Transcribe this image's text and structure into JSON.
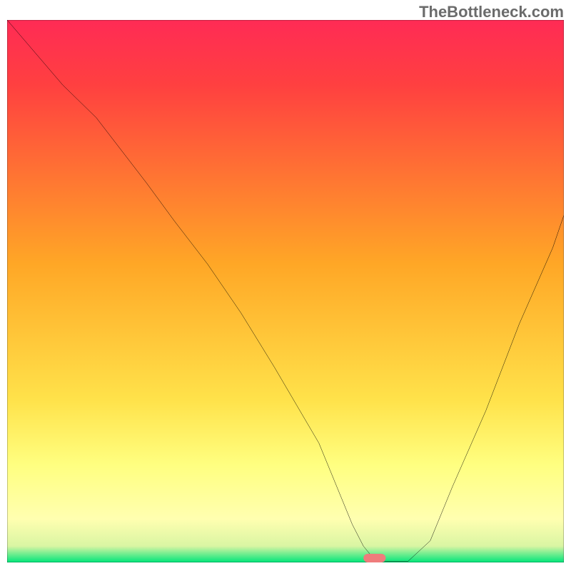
{
  "watermark": "TheBottleneck.com",
  "chart_data": {
    "type": "line",
    "x_range": [
      0,
      100
    ],
    "y_range": [
      0,
      100
    ],
    "xlabel": "",
    "ylabel": "",
    "title": "",
    "background_gradient_stops": [
      {
        "offset": 0.0,
        "color": "#ff2b55"
      },
      {
        "offset": 0.12,
        "color": "#ff4040"
      },
      {
        "offset": 0.45,
        "color": "#ffa726"
      },
      {
        "offset": 0.7,
        "color": "#ffe24a"
      },
      {
        "offset": 0.82,
        "color": "#ffff80"
      },
      {
        "offset": 0.92,
        "color": "#ffffb0"
      },
      {
        "offset": 0.97,
        "color": "#d9f5a3"
      },
      {
        "offset": 1.0,
        "color": "#00e57a"
      }
    ],
    "series": [
      {
        "name": "bottleneck-curve",
        "color": "#000000",
        "stroke_width": 2.4,
        "x": [
          0,
          5,
          10,
          16,
          22,
          25,
          30,
          36,
          42,
          48,
          52,
          56,
          58,
          62,
          64,
          66,
          68,
          72,
          76,
          80,
          86,
          92,
          98,
          100
        ],
        "values": [
          100,
          94,
          88,
          82,
          74,
          70,
          63,
          55,
          46,
          36,
          29,
          22,
          17,
          7,
          3,
          0.5,
          0.2,
          0.2,
          4,
          14,
          28,
          44,
          58,
          64
        ]
      }
    ],
    "marker": {
      "shape": "pill",
      "color": "#ef7c7c",
      "x": 66,
      "y": 0,
      "width_pct": 4,
      "height_pct": 1.6
    },
    "grid": false,
    "legend": null
  }
}
